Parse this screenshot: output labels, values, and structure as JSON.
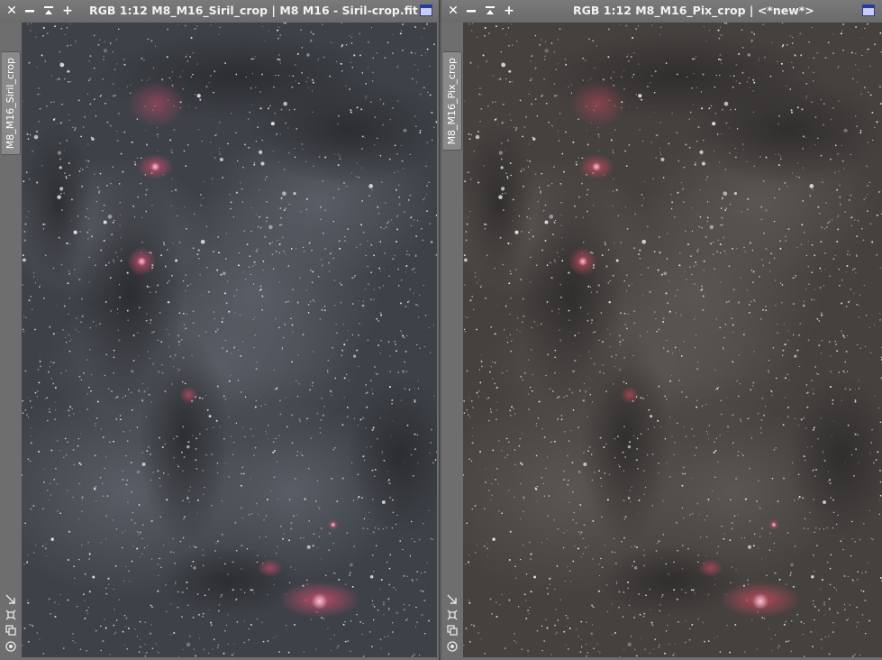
{
  "windows": [
    {
      "title": "RGB 1:12 M8_M16_Siril_crop | M8 M16 - Siril-crop.fit",
      "tab_label": "M8_M16_Siril_crop",
      "palette": {
        "base": "#3e4248",
        "dust": "#2a2b2e",
        "glow": "#5c6068",
        "neb": "#c04a6a"
      }
    },
    {
      "title": "RGB 1:12 M8_M16_Pix_crop | <*new*>",
      "tab_label": "M8_M16_Pix_crop",
      "palette": {
        "base": "#45413f",
        "dust": "#2e2c2b",
        "glow": "#5e5855",
        "neb": "#b8485a"
      }
    }
  ],
  "window_buttons": {
    "close": "close-icon",
    "minimize": "minimize-icon",
    "maximize": "maximize-icon",
    "add": "plus-icon",
    "shade": "shade-icon"
  },
  "side_icons": [
    "zoom-fit-icon",
    "fit-view-icon",
    "clone-icon",
    "target-icon"
  ]
}
